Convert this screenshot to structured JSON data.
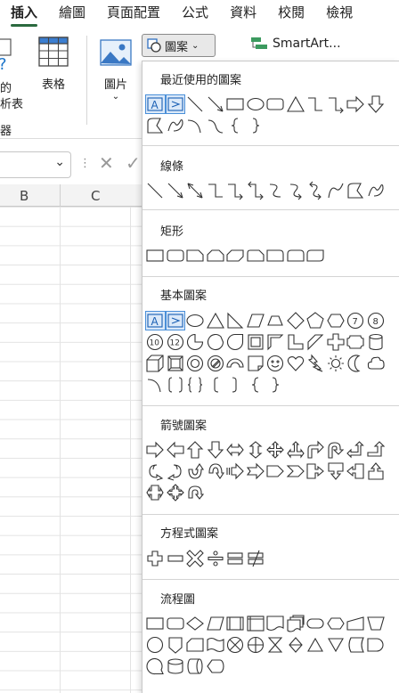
{
  "ribbon": {
    "tabs": [
      "插入",
      "繪圖",
      "頁面配置",
      "公式",
      "資料",
      "校閱",
      "檢視"
    ],
    "active_tab": "插入",
    "left_partial_label_1": "的",
    "left_partial_label_2": "析表",
    "left_group_partial": "器",
    "table_label": "表格",
    "pictures_label": "圖片",
    "shapes_label": "圖案",
    "smartart_label": "SmartArt...",
    "accent_color": "#2b6a3f"
  },
  "sheet": {
    "columns": [
      "B",
      "C"
    ]
  },
  "shapes_menu": {
    "sections": [
      {
        "title": "最近使用的圖案"
      },
      {
        "title": "線條"
      },
      {
        "title": "矩形"
      },
      {
        "title": "基本圖案"
      },
      {
        "title": "箭號圖案"
      },
      {
        "title": "方程式圖案"
      },
      {
        "title": "流程圖"
      }
    ],
    "oval_labels": [
      "7",
      "8",
      "10",
      "12"
    ],
    "selection_color": "#4a8fd8"
  }
}
